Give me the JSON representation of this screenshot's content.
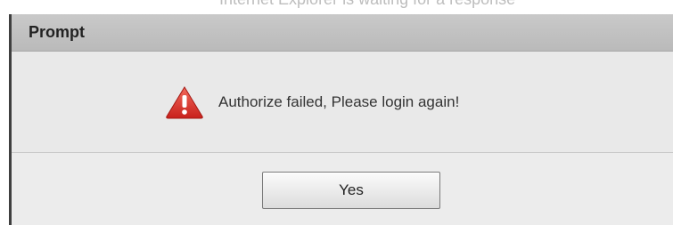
{
  "top_cutoff_text": "Internet Explorer is waiting for a response",
  "dialog": {
    "title": "Prompt",
    "message": "Authorize failed, Please login again!",
    "icon": "warning-icon",
    "yes_label": "Yes"
  },
  "colors": {
    "header_bg": "#c2c2c2",
    "content_bg": "#e9e9e9",
    "warning_red": "#e02b27"
  }
}
